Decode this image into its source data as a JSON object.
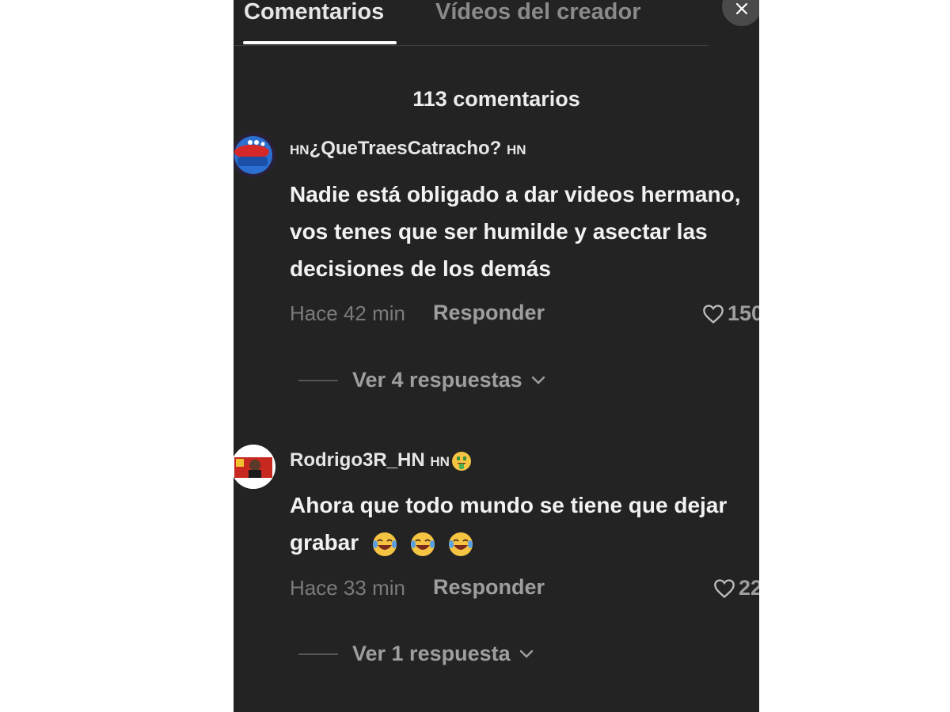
{
  "tabs": [
    {
      "label": "Comentarios",
      "active": true
    },
    {
      "label": "Vídeos del creador",
      "active": false
    }
  ],
  "comments_count": "113 comentarios",
  "comments": [
    {
      "username": "¿QueTraesCatracho?",
      "prefix_badge": "HN",
      "suffix_badge": "HN",
      "text": "Nadie está obligado a dar videos hermano, vos tenes que ser humilde y asectar las decisiones de los demás",
      "time": "Hace 42 min",
      "reply_label": "Responder",
      "likes": "150",
      "view_replies": "Ver 4 respuestas"
    },
    {
      "username": "Rodrigo3R_HN",
      "suffix_badge": "HN",
      "text": "Ahora que todo mundo se tiene que dejar grabar",
      "time": "Hace 33 min",
      "reply_label": "Responder",
      "likes": "22",
      "view_replies": "Ver 1 respuesta"
    }
  ],
  "icons": {
    "close": "close-icon",
    "like": "heart-outline-icon",
    "chevron": "chevron-down-icon",
    "laugh_emoji": "laughing-tears-emoji",
    "money_emoji": "money-mouth-emoji"
  },
  "colors": {
    "panel_bg": "#232323",
    "text_primary": "#f2f2f2",
    "text_muted": "#9e9e9e"
  }
}
